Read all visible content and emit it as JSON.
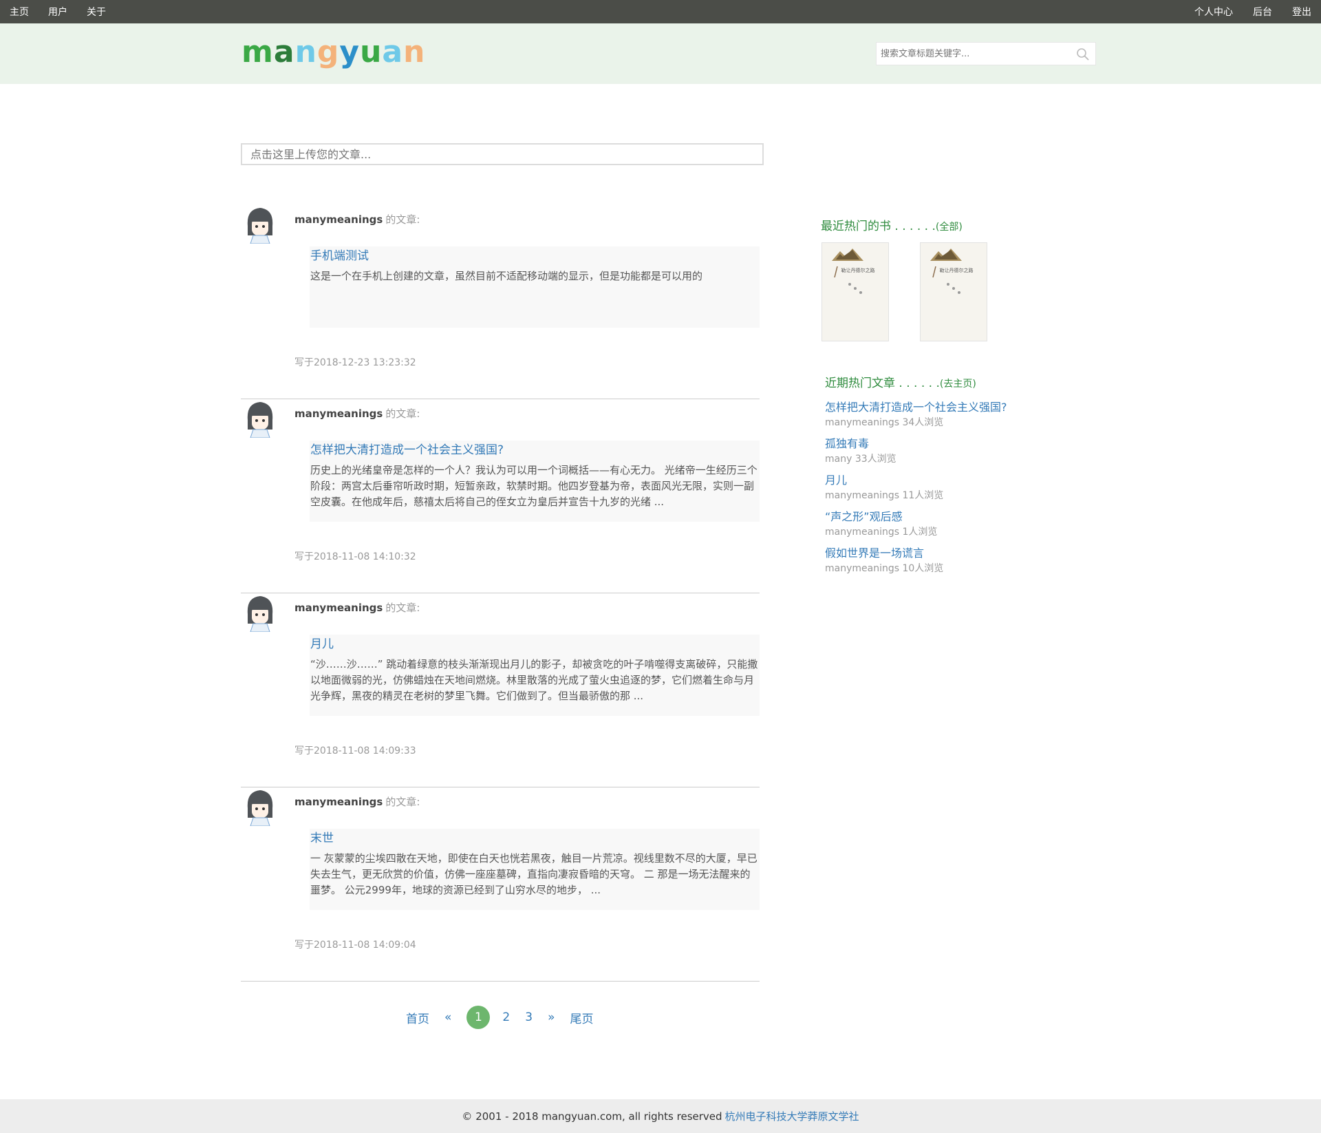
{
  "topnav": {
    "left": [
      "主页",
      "用户",
      "关于"
    ],
    "right": [
      "个人中心",
      "后台",
      "登出"
    ]
  },
  "header": {
    "logo_letters": [
      {
        "ch": "m",
        "color": "#3aa845"
      },
      {
        "ch": "a",
        "color": "#2c7c3a"
      },
      {
        "ch": "n",
        "color": "#6ec9e8"
      },
      {
        "ch": "g",
        "color": "#f4b27a"
      },
      {
        "ch": "y",
        "color": "#2c8fc9"
      },
      {
        "ch": "u",
        "color": "#3aa845"
      },
      {
        "ch": "a",
        "color": "#6ec9e8"
      },
      {
        "ch": "n",
        "color": "#f4b27a"
      }
    ],
    "search_placeholder": "搜索文章标题关键字..."
  },
  "upload": {
    "placeholder": "点击这里上传您的文章..."
  },
  "posts": [
    {
      "author": "manymeanings",
      "suffix": "的文章:",
      "title": "手机端测试",
      "excerpt": "这是一个在手机上创建的文章，虽然目前不适配移动端的显示，但是功能都是可以用的",
      "date": "写于2018-12-23 13:23:32"
    },
    {
      "author": "manymeanings",
      "suffix": "的文章:",
      "title": "怎样把大清打造成一个社会主义强国?",
      "excerpt": "历史上的光绪皇帝是怎样的一个人？我认为可以用一个词概括——有心无力。 光绪帝一生经历三个阶段：两宫太后垂帘听政时期，短暂亲政，软禁时期。他四岁登基为帝，表面风光无限，实则一副空皮囊。在他成年后，慈禧太后将自己的侄女立为皇后并宣告十九岁的光绪 ...",
      "date": "写于2018-11-08 14:10:32"
    },
    {
      "author": "manymeanings",
      "suffix": "的文章:",
      "title": "月儿",
      "excerpt": "“沙……沙……” 跳动着绿意的枝头渐渐现出月儿的影子，却被贪吃的叶子啃噬得支离破碎，只能撒以地面微弱的光，仿佛蜡烛在天地间燃烧。林里散落的光成了萤火虫追逐的梦，它们燃着生命与月光争辉，黑夜的精灵在老树的梦里飞舞。它们做到了。但当最骄傲的那 ...",
      "date": "写于2018-11-08 14:09:33"
    },
    {
      "author": "manymeanings",
      "suffix": "的文章:",
      "title": "末世",
      "excerpt": "一 灰蒙蒙的尘埃四散在天地，即使在白天也恍若黑夜，触目一片荒凉。视线里数不尽的大厦，早已失去生气，更无欣赏的价值，仿佛一座座墓碑，直指向凄寂昏暗的天穹。 二 那是一场无法醒来的噩梦。 公元2999年，地球的资源已经到了山穷水尽的地步， ...",
      "date": "写于2018-11-08 14:09:04"
    }
  ],
  "sidebar": {
    "books_title": "最近热门的书 . . . . . .",
    "books_link": "(全部)",
    "books": [
      {
        "cover_title": "勒让丹德尔之路",
        "cover_icon": "mountain-icon"
      },
      {
        "cover_title": "勒让丹德尔之路",
        "cover_icon": "mountain-icon"
      }
    ],
    "articles_title": "近期热门文章 . . . . . .",
    "articles_link": "(去主页)",
    "articles": [
      {
        "title": "怎样把大清打造成一个社会主义强国?",
        "meta": "manymeanings 34人浏览"
      },
      {
        "title": "孤独有毒",
        "meta": "many 33人浏览"
      },
      {
        "title": "月儿",
        "meta": "manymeanings 11人浏览"
      },
      {
        "title": "“声之形”观后感",
        "meta": "manymeanings 1人浏览"
      },
      {
        "title": "假如世界是一场谎言",
        "meta": "manymeanings 10人浏览"
      }
    ]
  },
  "pagination": {
    "first": "首页",
    "prev": "«",
    "pages": [
      "1",
      "2",
      "3"
    ],
    "current": "1",
    "next": "»",
    "last": "尾页"
  },
  "footer": {
    "copyright": "© 2001 - 2018 mangyuan.com, all rights reserved",
    "org": "杭州电子科技大学莽原文学社"
  },
  "colors": {
    "topbar": "#4b4d48",
    "header_bg": "#eaf3ea",
    "link": "#337ab7",
    "sidebar_heading": "#2e8b3d",
    "pager_current": "#6db66d"
  }
}
